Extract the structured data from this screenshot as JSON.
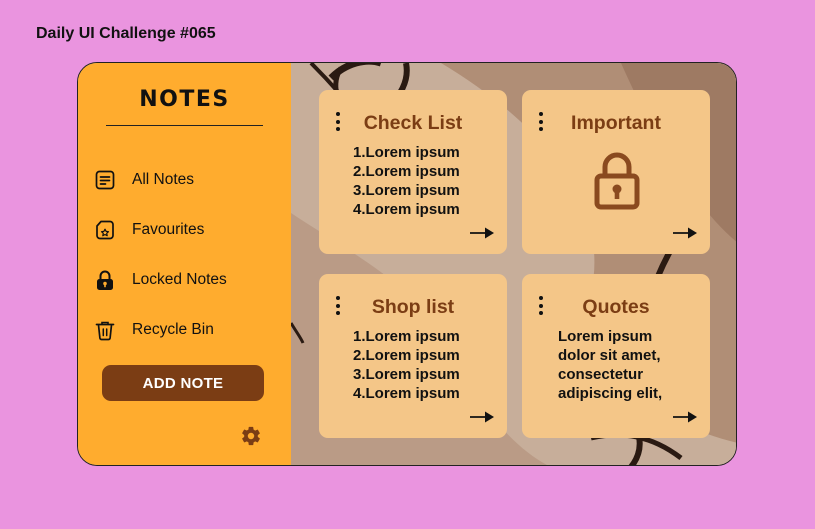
{
  "page": {
    "heading": "Daily UI Challenge #065"
  },
  "sidebar": {
    "brand": "NOTES",
    "items": [
      {
        "label": "All Notes",
        "icon": "notes-icon"
      },
      {
        "label": "Favourites",
        "icon": "favourite-file-icon"
      },
      {
        "label": "Locked Notes",
        "icon": "lock-icon"
      },
      {
        "label": "Recycle Bin",
        "icon": "trash-icon"
      }
    ],
    "add_button": "ADD NOTE",
    "settings_icon": "gear-icon"
  },
  "cards": [
    {
      "title": "Check List",
      "lines": [
        "1.Lorem ipsum",
        "2.Lorem ipsum",
        "3.Lorem ipsum",
        "4.Lorem ipsum"
      ]
    },
    {
      "title": "Important",
      "icon": "padlock-icon"
    },
    {
      "title": "Shop list",
      "lines": [
        "1.Lorem ipsum",
        "2.Lorem ipsum",
        "3.Lorem ipsum",
        "4.Lorem ipsum"
      ]
    },
    {
      "title": "Quotes",
      "text": [
        "Lorem ipsum",
        "dolor sit amet,",
        "consectetur",
        "adipiscing elit,"
      ]
    }
  ],
  "colors": {
    "page_bg": "#ea94df",
    "sidebar_bg": "#ffac2e",
    "accent_brown": "#7b3d14",
    "card_bg": "#f4c688",
    "content_bg": "#c7ae9a"
  }
}
